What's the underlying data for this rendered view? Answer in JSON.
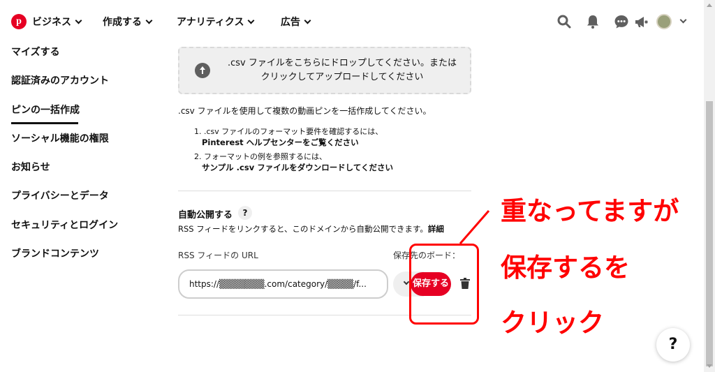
{
  "nav": {
    "logo_letter": "p",
    "business": "ビジネス",
    "create": "作成する",
    "analytics": "アナリティクス",
    "ads": "広告"
  },
  "sidebar": {
    "items": [
      {
        "label": "マイズする"
      },
      {
        "label": "認証済みのアカウント"
      },
      {
        "label": "ピンの一括作成",
        "active": true
      },
      {
        "label": "ソーシャル機能の権限"
      },
      {
        "label": "お知らせ"
      },
      {
        "label": "プライバシーとデータ"
      },
      {
        "label": "セキュリティとログイン"
      },
      {
        "label": "ブランドコンテンツ"
      }
    ]
  },
  "dropzone": {
    "line1": ".csv ファイルをこちらにドロップしてください。または",
    "line2": "クリックしてアップロードしてください"
  },
  "bulk": {
    "description": ".csv ファイルを使用して複数の動画ピンを一括作成してください。",
    "step1_text": "1. .csv ファイルのフォーマット要件を確認するには、",
    "step1_link": "Pinterest ヘルプセンターをご覧ください",
    "step2_text": "2. フォーマットの例を参照するには、",
    "step2_link": "サンプル .csv ファイルをダウンロードしてください"
  },
  "autopublish": {
    "title": "自動公開する",
    "help": "?",
    "description": "RSS フィードをリンクすると、このドメインから自動公開できます。",
    "detail_link": "詳細",
    "url_label": "RSS フィードの URL",
    "board_label": "保存先のボード：",
    "url_value": "https://▒▒▒▒▒▒▒.com/category/▒▒▒▒/f...",
    "save_label": "保存する"
  },
  "annotation": {
    "line1": "重なってますが",
    "line2": "保存するを",
    "line3": "クリック",
    "color": "#ff0000"
  },
  "help_fab": "?",
  "colors": {
    "brand": "#e60023",
    "text": "#111111",
    "annotation": "#ff0000"
  }
}
